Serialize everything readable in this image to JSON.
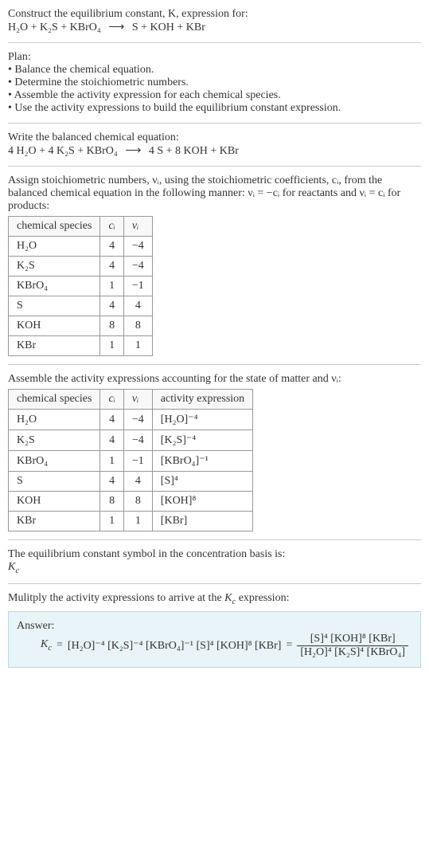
{
  "intro": {
    "line1": "Construct the equilibrium constant, K, expression for:",
    "equation_lhs": "H₂O + K₂S + KBrO₄",
    "arrow": "⟶",
    "equation_rhs": "S + KOH + KBr"
  },
  "plan": {
    "heading": "Plan:",
    "items": [
      "• Balance the chemical equation.",
      "• Determine the stoichiometric numbers.",
      "• Assemble the activity expression for each chemical species.",
      "• Use the activity expressions to build the equilibrium constant expression."
    ]
  },
  "balanced": {
    "heading": "Write the balanced chemical equation:",
    "lhs": "4 H₂O + 4 K₂S + KBrO₄",
    "arrow": "⟶",
    "rhs": "4 S + 8 KOH + KBr"
  },
  "assign": {
    "text": "Assign stoichiometric numbers, νᵢ, using the stoichiometric coefficients, cᵢ, from the balanced chemical equation in the following manner: νᵢ = −cᵢ for reactants and νᵢ = cᵢ for products:"
  },
  "table1": {
    "headers": [
      "chemical species",
      "cᵢ",
      "νᵢ"
    ],
    "rows": [
      [
        "H₂O",
        "4",
        "−4"
      ],
      [
        "K₂S",
        "4",
        "−4"
      ],
      [
        "KBrO₄",
        "1",
        "−1"
      ],
      [
        "S",
        "4",
        "4"
      ],
      [
        "KOH",
        "8",
        "8"
      ],
      [
        "KBr",
        "1",
        "1"
      ]
    ]
  },
  "assemble": {
    "text": "Assemble the activity expressions accounting for the state of matter and νᵢ:"
  },
  "table2": {
    "headers": [
      "chemical species",
      "cᵢ",
      "νᵢ",
      "activity expression"
    ],
    "rows": [
      [
        "H₂O",
        "4",
        "−4",
        "[H₂O]⁻⁴"
      ],
      [
        "K₂S",
        "4",
        "−4",
        "[K₂S]⁻⁴"
      ],
      [
        "KBrO₄",
        "1",
        "−1",
        "[KBrO₄]⁻¹"
      ],
      [
        "S",
        "4",
        "4",
        "[S]⁴"
      ],
      [
        "KOH",
        "8",
        "8",
        "[KOH]⁸"
      ],
      [
        "KBr",
        "1",
        "1",
        "[KBr]"
      ]
    ]
  },
  "eqconst": {
    "line1": "The equilibrium constant symbol in the concentration basis is:",
    "symbol": "K_c"
  },
  "multiply": {
    "text": "Mulitply the activity expressions to arrive at the K_c expression:"
  },
  "answer": {
    "label": "Answer:",
    "kc": "K_c",
    "eq": "=",
    "expr": "[H₂O]⁻⁴ [K₂S]⁻⁴ [KBrO₄]⁻¹ [S]⁴ [KOH]⁸ [KBr]",
    "eq2": "=",
    "num": "[S]⁴ [KOH]⁸ [KBr]",
    "den": "[H₂O]⁴ [K₂S]⁴ [KBrO₄]"
  }
}
